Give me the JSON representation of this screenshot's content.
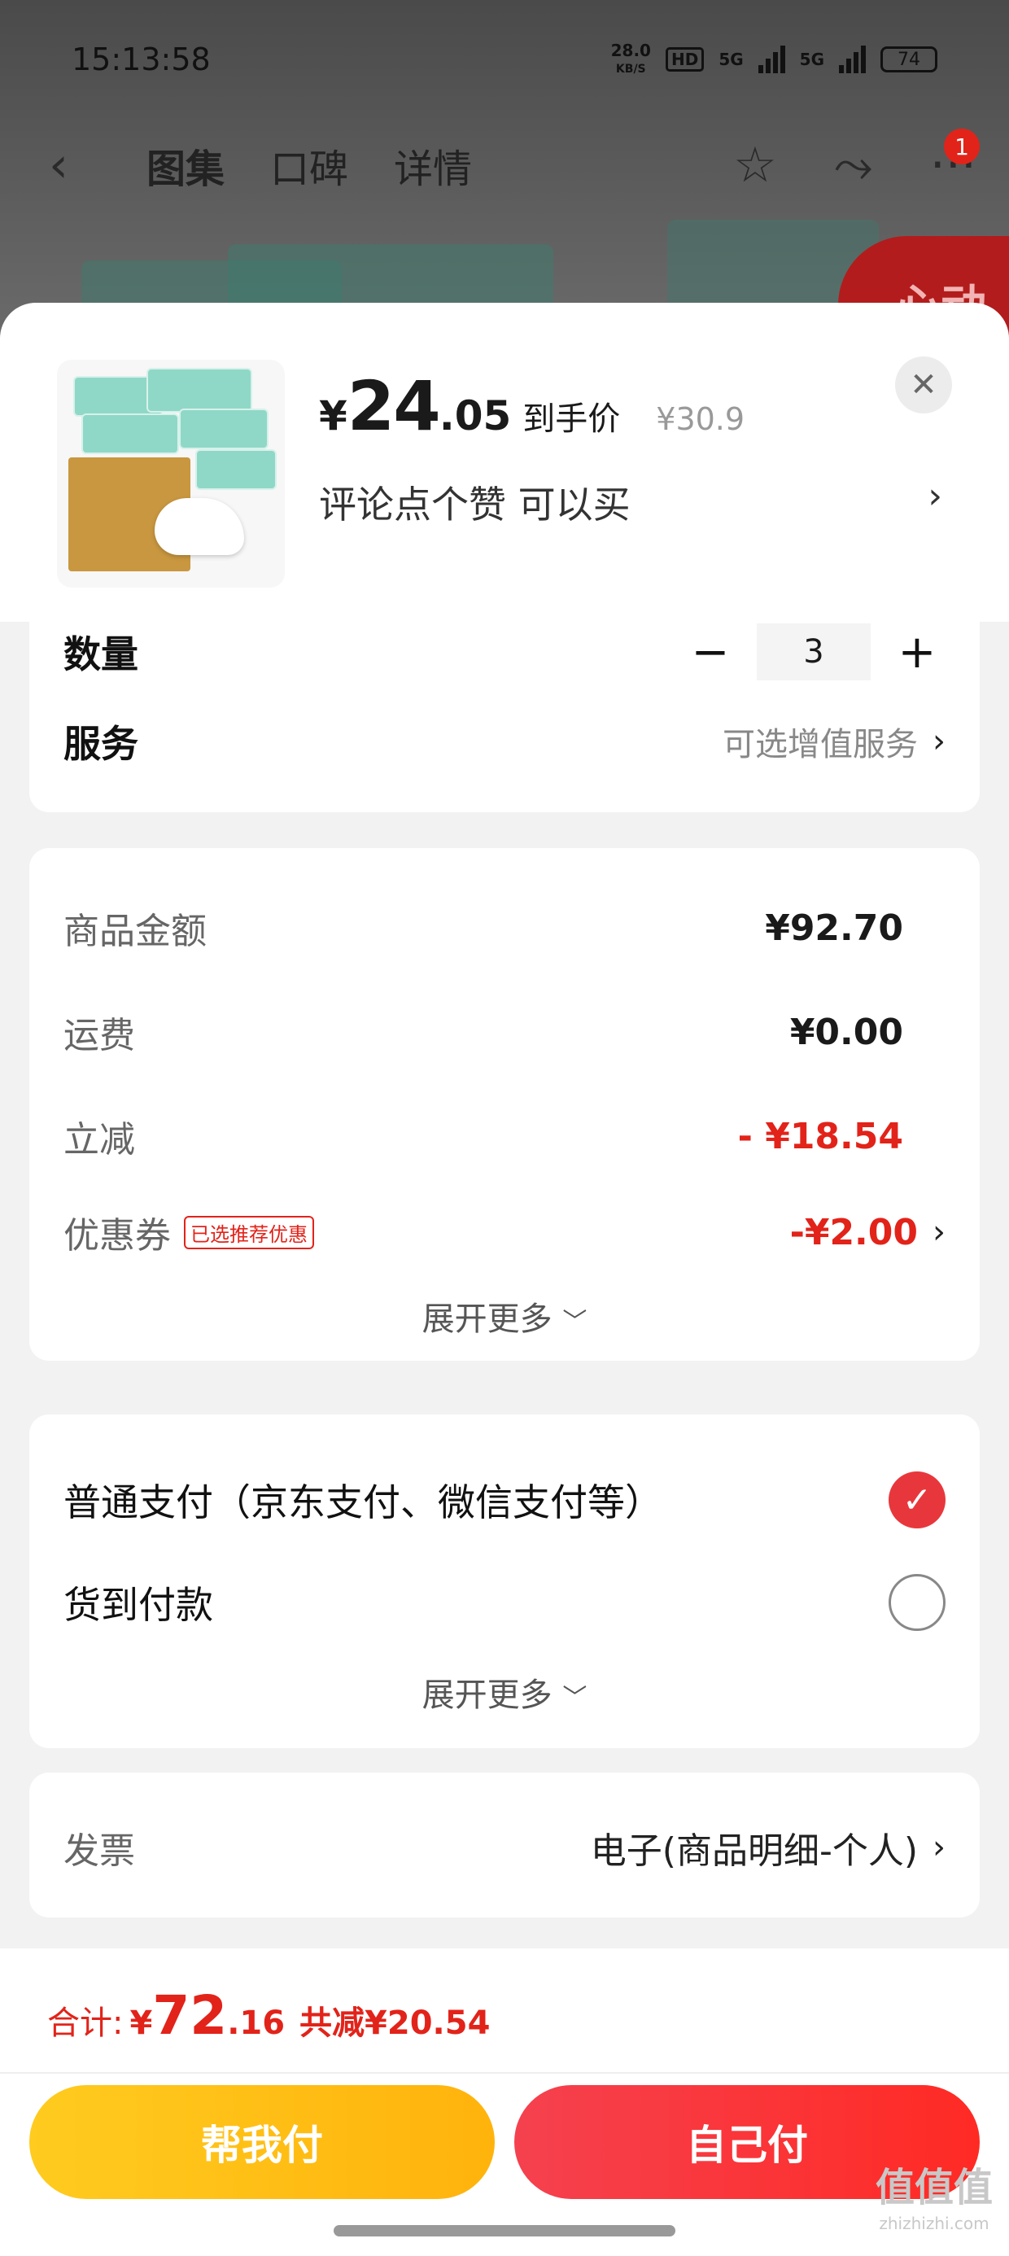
{
  "status_bar": {
    "time": "15:13:58",
    "net_speed": "28.0",
    "net_unit": "KB/S",
    "hd": "HD",
    "sig1": "5G",
    "sig2": "5G",
    "battery": "74"
  },
  "top_nav": {
    "tabs": [
      "图集",
      "口碑",
      "详情"
    ],
    "badge": "1"
  },
  "product": {
    "price_symbol": "¥",
    "price_int": "24",
    "price_dec": ".05",
    "price_label": "到手价",
    "original_price": "¥30.9",
    "promo_text": "评论点个赞  可以买"
  },
  "options": {
    "qty_label": "数量",
    "qty_value": "3",
    "service_label": "服务",
    "service_value": "可选增值服务"
  },
  "summary": {
    "amount_label": "商品金额",
    "amount_value": "¥92.70",
    "shipping_label": "运费",
    "shipping_value": "¥0.00",
    "discount_label": "立减",
    "discount_value": "- ¥18.54",
    "coupon_label": "优惠券",
    "coupon_tag": "已选推荐优惠",
    "coupon_value": "-¥2.00",
    "expand": "展开更多"
  },
  "payment": {
    "option1": "普通支付（京东支付、微信支付等）",
    "option2": "货到付款",
    "expand": "展开更多"
  },
  "invoice": {
    "label": "发票",
    "value": "电子(商品明细-个人)"
  },
  "footer": {
    "total_label": "合计:",
    "total_symbol": "¥",
    "total_int": "72",
    "total_dec": ".16",
    "total_saving": "共减¥20.54",
    "help_pay": "帮我付",
    "self_pay": "自己付"
  },
  "watermark": {
    "logo": "值值值",
    "site": "zhizhizhi.com"
  },
  "colors": {
    "accent_red": "#e2231a",
    "help_btn": "#ffb30c",
    "self_btn": "#ff2a24"
  }
}
